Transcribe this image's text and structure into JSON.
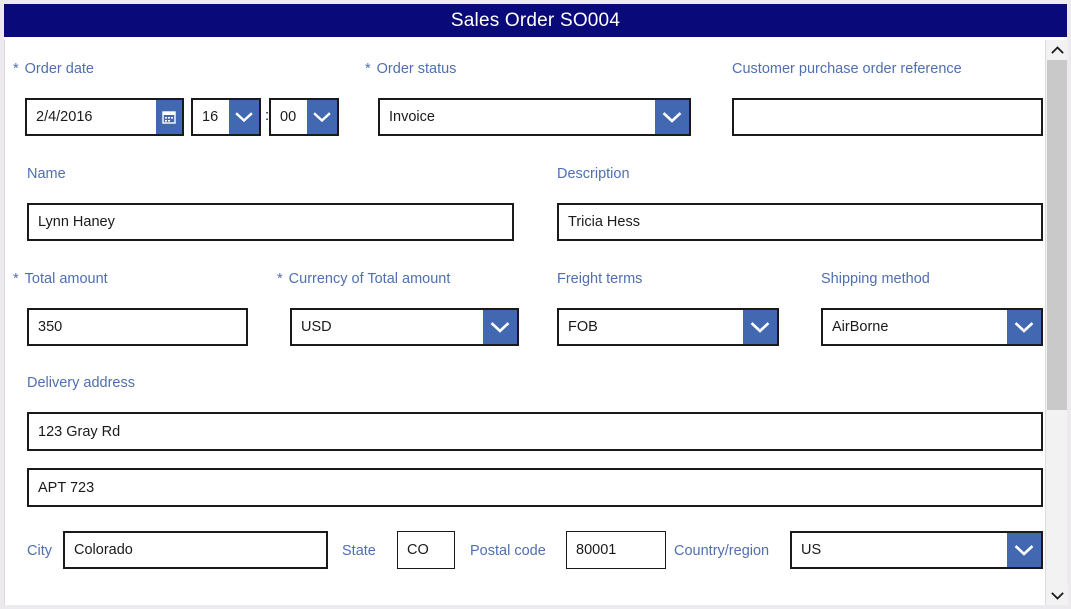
{
  "window": {
    "title": "Sales Order SO004"
  },
  "form": {
    "order_date": {
      "label": "Order date",
      "required_marker": "*",
      "value": "2/4/2016",
      "icon": "calendar-icon",
      "hour": "16",
      "minute": "00",
      "time_separator": ":"
    },
    "order_status": {
      "label": "Order status",
      "required_marker": "*",
      "value": "Invoice"
    },
    "customer_po_reference": {
      "label": "Customer purchase order reference",
      "value": "",
      "placeholder": ""
    },
    "name": {
      "label": "Name",
      "value": "Lynn Haney"
    },
    "description": {
      "label": "Description",
      "value": "Tricia Hess"
    },
    "total_amount": {
      "label": "Total amount",
      "required_marker": "*",
      "value": "350"
    },
    "currency": {
      "label": "Currency of Total amount",
      "required_marker": "*",
      "value": "USD"
    },
    "freight_terms": {
      "label": "Freight terms",
      "value": "FOB"
    },
    "shipping_method": {
      "label": "Shipping method",
      "value": "AirBorne"
    },
    "delivery_address": {
      "label": "Delivery address",
      "line1": "123 Gray Rd",
      "line2": "APT 723"
    },
    "city": {
      "label": "City",
      "value": "Colorado"
    },
    "state": {
      "label": "State",
      "value": "CO"
    },
    "postal_code": {
      "label": "Postal code",
      "value": "80001"
    },
    "country_region": {
      "label": "Country/region",
      "value": "US"
    }
  },
  "scrollbar": {
    "up_icon": "chevron-up-icon",
    "down_icon": "chevron-down-icon"
  },
  "colors": {
    "header_bg": "#090979",
    "header_text": "#ffffff",
    "label_blue": "#4f6fb0",
    "dropdown_button": "#4168b0",
    "field_border": "#1a1a1a",
    "page_bg": "#ffffff"
  }
}
